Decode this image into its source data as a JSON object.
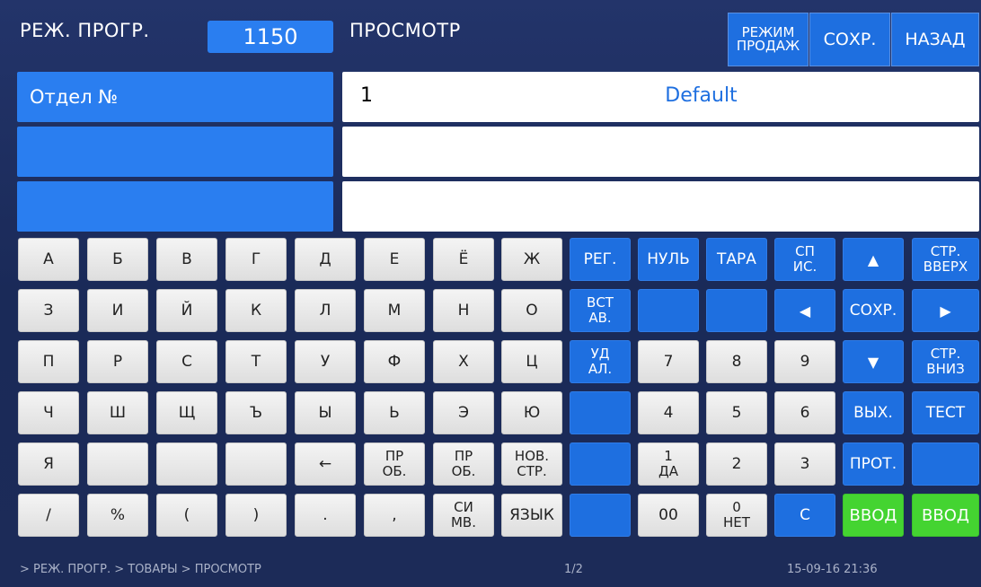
{
  "header": {
    "mode_label": "РЕЖ. ПРОГР.",
    "number": "1150",
    "screen_label": "ПРОСМОТР",
    "btn_sale_mode_line1": "РЕЖИМ",
    "btn_sale_mode_line2": "ПРОДАЖ",
    "btn_save": "СОХР.",
    "btn_back": "НАЗАД"
  },
  "fields": {
    "dept_label": "Отдел №",
    "dept_number": "1",
    "dept_name": "Default"
  },
  "keyboard": {
    "letters": [
      [
        "А",
        "Б",
        "В",
        "Г",
        "Д",
        "Е",
        "Ё",
        "Ж"
      ],
      [
        "З",
        "И",
        "Й",
        "К",
        "Л",
        "М",
        "Н",
        "О"
      ],
      [
        "П",
        "Р",
        "С",
        "Т",
        "У",
        "Ф",
        "Х",
        "Ц"
      ],
      [
        "Ч",
        "Ш",
        "Щ",
        "Ъ",
        "Ы",
        "Ь",
        "Э",
        "Ю"
      ],
      [
        "Я",
        "",
        "",
        "",
        "←",
        "ПР|ОБ.",
        "ПР|ОБ.",
        "НОВ.|СТР."
      ],
      [
        "/",
        "%",
        "(",
        ")",
        ".",
        ",",
        "СИ|МВ.",
        "ЯЗЫК"
      ]
    ],
    "func": {
      "reg": "РЕГ.",
      "zero": "НУЛЬ",
      "tare": "ТАРА",
      "list_l1": "СП",
      "list_l2": "ИС.",
      "page_up_l1": "СТР.",
      "page_up_l2": "ВВЕРХ",
      "insert_l1": "ВСТ",
      "insert_l2": "АВ.",
      "save": "СОХР.",
      "delete_l1": "УД",
      "delete_l2": "АЛ.",
      "page_down_l1": "СТР.",
      "page_down_l2": "ВНИЗ",
      "exit": "ВЫХ.",
      "test": "ТЕСТ",
      "prot": "ПРОТ.",
      "clear": "C",
      "enter1": "ВВОД",
      "enter2": "ВВОД"
    },
    "digits": {
      "d7": "7",
      "d8": "8",
      "d9": "9",
      "d4": "4",
      "d5": "5",
      "d6": "6",
      "d1_top": "1",
      "d1_bot": "ДА",
      "d2": "2",
      "d3": "3",
      "d00": "00",
      "d0_top": "0",
      "d0_bot": "НЕТ"
    }
  },
  "status_bar": {
    "breadcrumb": "> РЕЖ. ПРОГР.  > ТОВАРЫ > ПРОСМОТР",
    "page": "1/2",
    "datetime": "15-09-16  21:36"
  },
  "colors": {
    "background": "#1b2a55",
    "key_blue": "#1e6fe0",
    "field_blue": "#2a7ef0",
    "key_green": "#44d431"
  }
}
